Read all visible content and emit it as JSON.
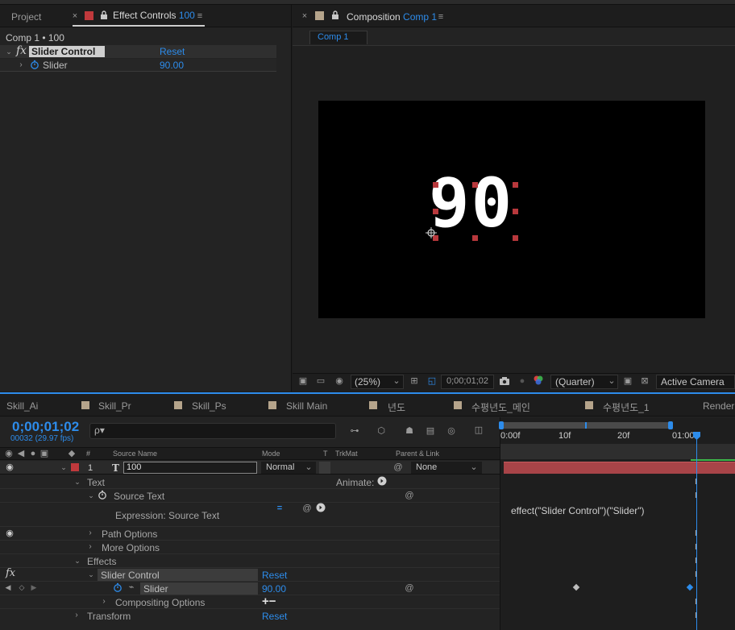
{
  "colors": {
    "accent": "#2d8ceb",
    "label_red": "#c0393c",
    "layer_bar": "#a84448",
    "handle": "#b8383c",
    "sand_swatch": "#b5a48b"
  },
  "ec": {
    "tab_project": "Project",
    "tab_title": "Effect Controls",
    "tab_layer": "100",
    "header": "Comp 1 • 100",
    "fx_label": "fx",
    "effect_name": "Slider Control",
    "reset": "Reset",
    "slider_label": "Slider",
    "slider_value": "90.00"
  },
  "comp": {
    "tab_title": "Composition",
    "tab_name": "Comp 1",
    "subtab": "Comp 1",
    "text_layer_content": "90",
    "zoom": "(25%)",
    "timecode": "0;00;01;02",
    "resolution": "(Quarter)",
    "camera": "Active Camera"
  },
  "tl": {
    "tabs": [
      "Skill_Ai",
      "Skill_Pr",
      "Skill_Ps",
      "Skill Main",
      "년도",
      "수평년도_메인",
      "수평년도_1",
      "Render Q"
    ],
    "timecode": "0;00;01;02",
    "frames": "00032 (29.97 fps)",
    "search_placeholder": "ρ▾",
    "headers": {
      "hash": "#",
      "source": "Source Name",
      "mode": "Mode",
      "t": "T",
      "trkmat": "TrkMat",
      "parent": "Parent & Link"
    },
    "layer": {
      "num": "1",
      "type": "T",
      "name": "100",
      "mode": "Normal",
      "parent": "None"
    },
    "props": {
      "text": "Text",
      "animate": "Animate:",
      "source_text": "Source Text",
      "expression": "Expression: Source Text",
      "expr_code": "effect(\"Slider Control\")(\"Slider\")",
      "path_options": "Path Options",
      "more_options": "More Options",
      "effects": "Effects",
      "fx": "fx",
      "slider_control": "Slider Control",
      "reset": "Reset",
      "slider": "Slider",
      "slider_value": "90.00",
      "compositing": "Compositing Options",
      "plus_minus": "+−",
      "transform": "Transform",
      "transform_reset": "Reset"
    },
    "ruler": [
      "0:00f",
      "10f",
      "20f",
      "01:00"
    ]
  }
}
